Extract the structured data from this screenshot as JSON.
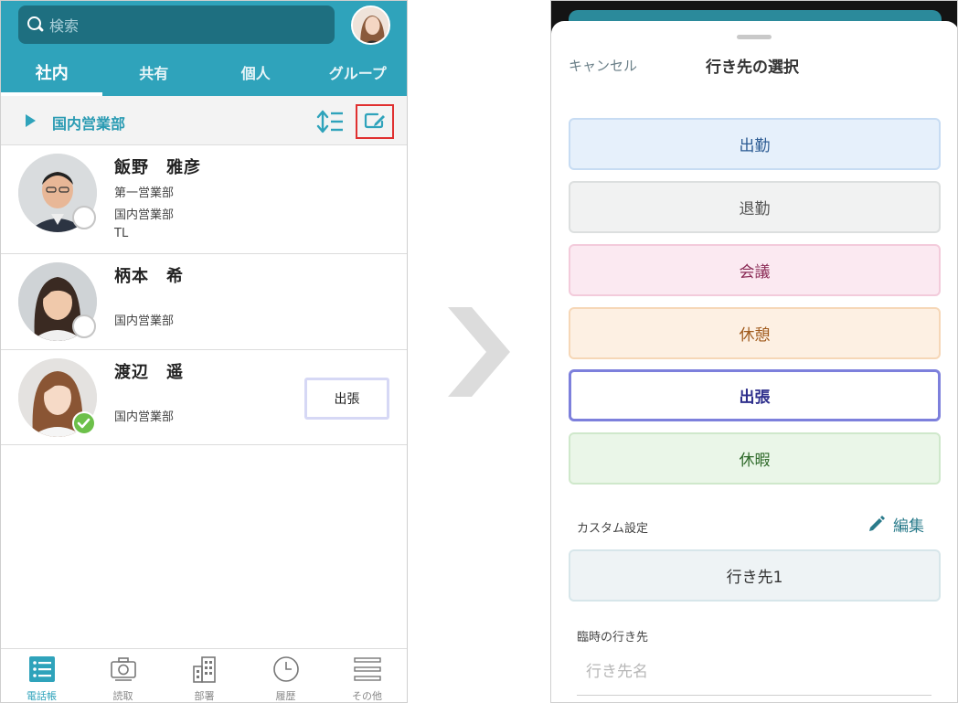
{
  "left": {
    "search": {
      "placeholder": "検索"
    },
    "tabs": [
      {
        "label": "社内",
        "active": true
      },
      {
        "label": "共有",
        "active": false
      },
      {
        "label": "個人",
        "active": false
      },
      {
        "label": "グループ",
        "active": false
      }
    ],
    "department": {
      "name": "国内営業部",
      "icons": [
        "sort-icon",
        "edit-status-icon"
      ]
    },
    "contacts": [
      {
        "name": "飯野　雅彦",
        "lines": [
          "第一営業部",
          "国内営業部",
          "TL"
        ],
        "status": "",
        "presence": "offline"
      },
      {
        "name": "柄本　希",
        "lines": [
          "国内営業部"
        ],
        "status": "",
        "presence": "offline"
      },
      {
        "name": "渡辺　遥",
        "lines": [
          "国内営業部"
        ],
        "status": "出張",
        "presence": "online"
      }
    ],
    "bottom_nav": [
      {
        "label": "電話帳",
        "icon": "phonebook-icon",
        "active": true
      },
      {
        "label": "読取",
        "icon": "camera-icon",
        "active": false
      },
      {
        "label": "部署",
        "icon": "building-icon",
        "active": false
      },
      {
        "label": "履歴",
        "icon": "clock-icon",
        "active": false
      },
      {
        "label": "その他",
        "icon": "menu-icon",
        "active": false
      }
    ]
  },
  "right": {
    "cancel": "キャンセル",
    "title": "行き先の選択",
    "options": [
      {
        "label": "出勤",
        "bg": "#e6f0fb",
        "border": "#c7dcf3",
        "color": "#2c5b93",
        "selected": false
      },
      {
        "label": "退勤",
        "bg": "#f1f2f2",
        "border": "#dcdfdf",
        "color": "#555555",
        "selected": false
      },
      {
        "label": "会議",
        "bg": "#fbe9f1",
        "border": "#f3cbdb",
        "color": "#8a2a55",
        "selected": false
      },
      {
        "label": "休憩",
        "bg": "#fdf0e3",
        "border": "#f6d7b7",
        "color": "#a05a1c",
        "selected": false
      },
      {
        "label": "出張",
        "bg": "#ffffff",
        "border": "#7d80dc",
        "color": "#2e2f8c",
        "selected": true
      },
      {
        "label": "休暇",
        "bg": "#eaf6e8",
        "border": "#cfe8cb",
        "color": "#2f6a2a",
        "selected": false
      }
    ],
    "custom_section": {
      "label": "カスタム設定",
      "edit_label": "編集"
    },
    "custom_items": [
      {
        "label": "行き先1"
      }
    ],
    "temp_section": {
      "label": "臨時の行き先",
      "placeholder": "行き先名"
    }
  }
}
